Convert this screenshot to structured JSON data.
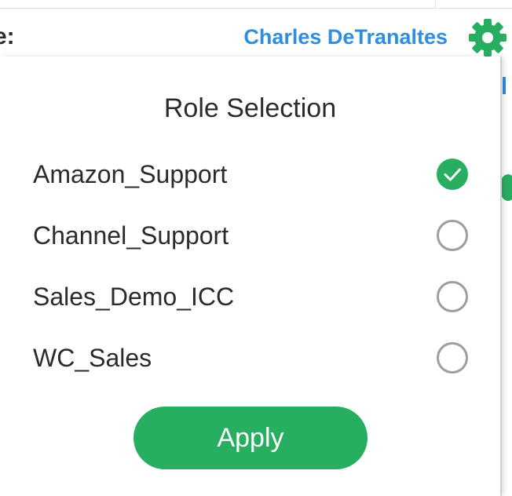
{
  "header": {
    "label_fragment": "e:",
    "user_name": "Charles DeTranaltes",
    "settings_icon": "gear-icon",
    "user_name_color": "#2f8ee0",
    "accent_color": "#27ae60"
  },
  "role_panel": {
    "title": "Role Selection",
    "roles": [
      {
        "label": "Amazon_Support",
        "selected": true
      },
      {
        "label": "Channel_Support",
        "selected": false
      },
      {
        "label": "Sales_Demo_ICC",
        "selected": false
      },
      {
        "label": "WC_Sales",
        "selected": false
      }
    ],
    "apply_label": "Apply"
  }
}
